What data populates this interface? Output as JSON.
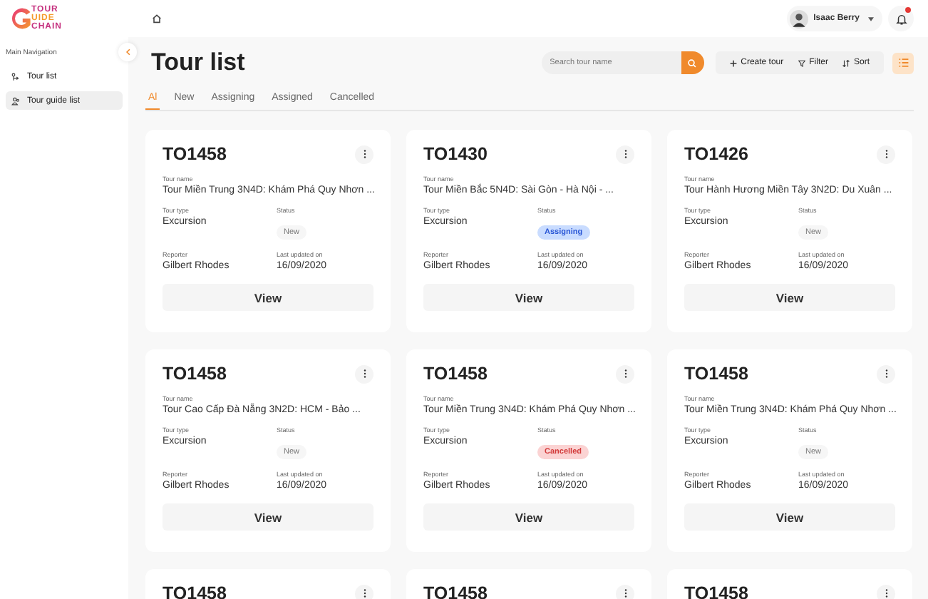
{
  "logo": {
    "lines": [
      "TOUR",
      "UIDE",
      "CHAIN"
    ]
  },
  "user": {
    "name": "Isaac Berry",
    "notification": true
  },
  "sidebar": {
    "heading": "Main Navigation",
    "items": [
      {
        "label": "Tour list",
        "selected": false
      },
      {
        "label": "Tour guide list",
        "selected": true
      }
    ]
  },
  "page": {
    "title": "Tour list"
  },
  "search": {
    "placeholder": "Search tour name"
  },
  "toolbar": [
    "Create tour",
    "Filter",
    "Sort"
  ],
  "tabs": [
    {
      "label": "Al",
      "selected": true
    },
    {
      "label": "New",
      "selected": false
    },
    {
      "label": "Assigning",
      "selected": false
    },
    {
      "label": "Assigned",
      "selected": false
    },
    {
      "label": "Cancelled",
      "selected": false
    }
  ],
  "cards": [
    {
      "id": "TO1458",
      "tour_name_label": "Tour name",
      "tour_name": "Tour Miền Trung 3N4D: Khám Phá Quy Nhơn ...",
      "type_label": "Tour type",
      "type": "Excursion",
      "status_label": "Status",
      "status": {
        "label": "New",
        "kind": "new"
      },
      "reporter_label": "Reporter",
      "reporter": "Gilbert Rhodes",
      "updated_label": "Last updated on",
      "updated": "16/09/2020",
      "button": "View"
    },
    {
      "id": "TO1430",
      "tour_name_label": "Tour name",
      "tour_name": "Tour Miền Bắc 5N4D: Sài Gòn - Hà Nội - ...",
      "type_label": "Tour type",
      "type": "Excursion",
      "status_label": "Status",
      "status": {
        "label": "Assigning",
        "kind": "assigning"
      },
      "reporter_label": "Reporter",
      "reporter": "Gilbert Rhodes",
      "updated_label": "Last updated on",
      "updated": "16/09/2020",
      "button": "View"
    },
    {
      "id": "TO1426",
      "tour_name_label": "Tour name",
      "tour_name": "Tour Hành Hương Miền Tây 3N2D: Du Xuân ...",
      "type_label": "Tour type",
      "type": "Excursion",
      "status_label": "Status",
      "status": {
        "label": "New",
        "kind": "new"
      },
      "reporter_label": "Reporter",
      "reporter": "Gilbert Rhodes",
      "updated_label": "Last updated on",
      "updated": "16/09/2020",
      "button": "View"
    },
    {
      "id": "TO1458",
      "tour_name_label": "Tour name",
      "tour_name": "Tour Cao Cấp Đà Nẵng 3N2D: HCM - Bảo ...",
      "type_label": "Tour type",
      "type": "Excursion",
      "status_label": "Status",
      "status": {
        "label": "New",
        "kind": "new"
      },
      "reporter_label": "Reporter",
      "reporter": "Gilbert Rhodes",
      "updated_label": "Last updated on",
      "updated": "16/09/2020",
      "button": "View"
    },
    {
      "id": "TO1458",
      "tour_name_label": "Tour name",
      "tour_name": "Tour Miền Trung 3N4D: Khám Phá Quy Nhơn ...",
      "type_label": "Tour type",
      "type": "Excursion",
      "status_label": "Status",
      "status": {
        "label": "Cancelled",
        "kind": "cancelled"
      },
      "reporter_label": "Reporter",
      "reporter": "Gilbert Rhodes",
      "updated_label": "Last updated on",
      "updated": "16/09/2020",
      "button": "View"
    },
    {
      "id": "TO1458",
      "tour_name_label": "Tour name",
      "tour_name": "Tour Miền Trung 3N4D: Khám Phá Quy Nhơn ...",
      "type_label": "Tour type",
      "type": "Excursion",
      "status_label": "Status",
      "status": {
        "label": "New",
        "kind": "new"
      },
      "reporter_label": "Reporter",
      "reporter": "Gilbert Rhodes",
      "updated_label": "Last updated on",
      "updated": "16/09/2020",
      "button": "View"
    }
  ],
  "partial_cards": [
    {
      "id": "TO1458"
    },
    {
      "id": "TO1458"
    },
    {
      "id": "TO1458"
    }
  ]
}
